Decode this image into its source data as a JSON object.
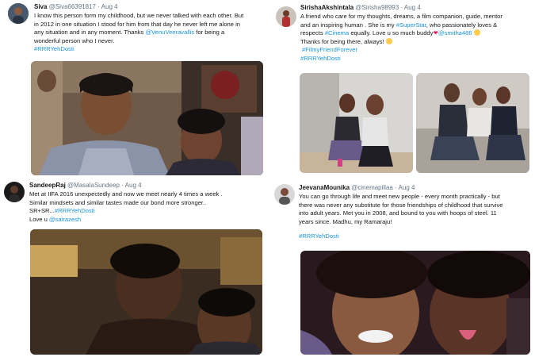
{
  "tweets": [
    {
      "name": "Siva",
      "handle": "@Siva66391817",
      "sep": "·",
      "time": "Aug 4",
      "text_lines": [
        "I know this person form my childhood, but we never talked with each other. But",
        "in 2012 in one situation I stood for him from that day he never left me alone in",
        "any situation and in any moment. Thanks ",
        "wonderful person who I never."
      ],
      "mention": "@VenuVeeravallis",
      "mention_suffix": " for being a",
      "hashtag": "#RRRYehDosti"
    },
    {
      "name": "SirishaAkshintala",
      "handle": "@Sirisha98993",
      "sep": "·",
      "time": "Aug 4",
      "text_lines": [
        "A friend who care for my thoughts, dreams, a film companion, guide,  mentor",
        "and an inspiring human . She is my ",
        ", who passionately loves &",
        "respects ",
        " equally. Love u so much buddy",
        "Thanks for being there, always! "
      ],
      "link_superstar": "#SuperStar",
      "link_cinema": "#Cinema",
      "mention": "@smitha486",
      "hashtag1": "#FilmyFriendForever",
      "hashtag2": "#RRRYehDosti"
    },
    {
      "name": "SandeepRaj",
      "handle": "@MasalaSundeep",
      "sep": "·",
      "time": "Aug 4",
      "text_lines": [
        "Met at IIFA 2016 unexpectedly and now we meet nearly 4 times a week .",
        "Similar mindsets and similar tastes made our bond more stronger..",
        "SR+SR...",
        "Love u "
      ],
      "hashtag": "#RRRYehDosti",
      "mention": "@sairazesh"
    },
    {
      "name": "JeevanaMounika",
      "handle": "@cinemapillaa",
      "sep": "·",
      "time": "Aug 4",
      "text_lines": [
        "You can go through life and meet new people - every month practically - but",
        "there was never any substitute for those friendships of childhood that survive",
        "into adult years. Met you in 2008, and bound to you with hoops of steel. 11",
        "years since. Madhu, my Ramaraju!"
      ],
      "hashtag": "#RRRYehDosti"
    }
  ],
  "colors": {
    "link": "#1b95e0",
    "muted": "#657786",
    "heart": "#e0245e",
    "text": "#14171a"
  },
  "icons": [
    "avatar",
    "red-heart-icon",
    "heart-eyes-emoji-icon",
    "smile-emoji-icon"
  ]
}
